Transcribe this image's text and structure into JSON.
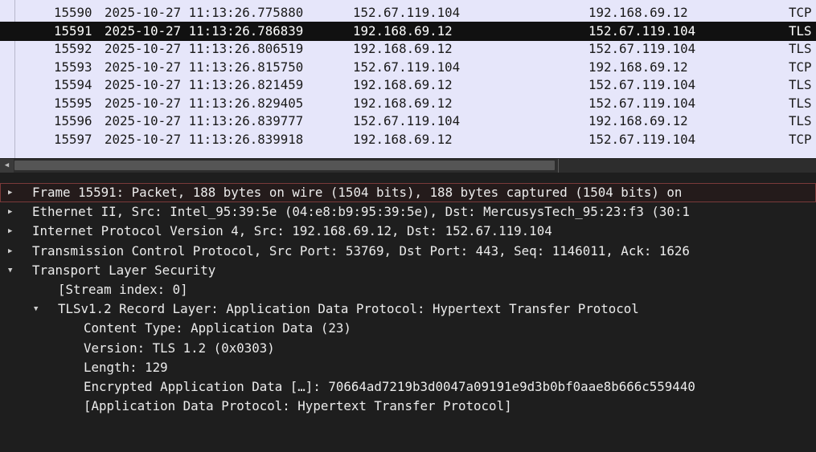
{
  "packet_list": {
    "rows": [
      {
        "no": "15590",
        "ts": "2025-10-27 11:13:26.775880",
        "src": "152.67.119.104",
        "dst": "192.168.69.12",
        "proto": "TCP"
      },
      {
        "no": "15591",
        "ts": "2025-10-27 11:13:26.786839",
        "src": "192.168.69.12",
        "dst": "152.67.119.104",
        "proto": "TLS"
      },
      {
        "no": "15592",
        "ts": "2025-10-27 11:13:26.806519",
        "src": "192.168.69.12",
        "dst": "152.67.119.104",
        "proto": "TLS"
      },
      {
        "no": "15593",
        "ts": "2025-10-27 11:13:26.815750",
        "src": "152.67.119.104",
        "dst": "192.168.69.12",
        "proto": "TCP"
      },
      {
        "no": "15594",
        "ts": "2025-10-27 11:13:26.821459",
        "src": "192.168.69.12",
        "dst": "152.67.119.104",
        "proto": "TLS"
      },
      {
        "no": "15595",
        "ts": "2025-10-27 11:13:26.829405",
        "src": "192.168.69.12",
        "dst": "152.67.119.104",
        "proto": "TLS"
      },
      {
        "no": "15596",
        "ts": "2025-10-27 11:13:26.839777",
        "src": "152.67.119.104",
        "dst": "192.168.69.12",
        "proto": "TLS"
      },
      {
        "no": "15597",
        "ts": "2025-10-27 11:13:26.839918",
        "src": "192.168.69.12",
        "dst": "152.67.119.104",
        "proto": "TCP"
      }
    ],
    "selected_index": 1
  },
  "scrollbar": {
    "arrow_icon": "chevron-left-icon"
  },
  "details": {
    "rows": [
      {
        "text": "Frame 15591: Packet, 188 bytes on wire (1504 bits), 188 bytes captured (1504 bits) on",
        "toggle": "collapsed",
        "level": 0
      },
      {
        "text": "Ethernet II, Src: Intel_95:39:5e (04:e8:b9:95:39:5e), Dst: MercusysTech_95:23:f3 (30:1",
        "toggle": "collapsed",
        "level": 0
      },
      {
        "text": "Internet Protocol Version 4, Src: 192.168.69.12, Dst: 152.67.119.104",
        "toggle": "collapsed",
        "level": 0
      },
      {
        "text": "Transmission Control Protocol, Src Port: 53769, Dst Port: 443, Seq: 1146011, Ack: 1626",
        "toggle": "collapsed",
        "level": 0
      },
      {
        "text": "Transport Layer Security",
        "toggle": "expanded",
        "level": 0
      },
      {
        "text": "[Stream index: 0]",
        "toggle": "none",
        "level": 1
      },
      {
        "text": "TLSv1.2 Record Layer: Application Data Protocol: Hypertext Transfer Protocol",
        "toggle": "expanded",
        "level": 1
      },
      {
        "text": "Content Type: Application Data (23)",
        "toggle": "none",
        "level": 2
      },
      {
        "text": "Version: TLS 1.2 (0x0303)",
        "toggle": "none",
        "level": 2
      },
      {
        "text": "Length: 129",
        "toggle": "none",
        "level": 2
      },
      {
        "text": "Encrypted Application Data […]: 70664ad7219b3d0047a09191e9d3b0bf0aae8b666c559440",
        "toggle": "none",
        "level": 2
      },
      {
        "text": "[Application Data Protocol: Hypertext Transfer Protocol]",
        "toggle": "none",
        "level": 2
      }
    ],
    "outlined_index": 0
  }
}
